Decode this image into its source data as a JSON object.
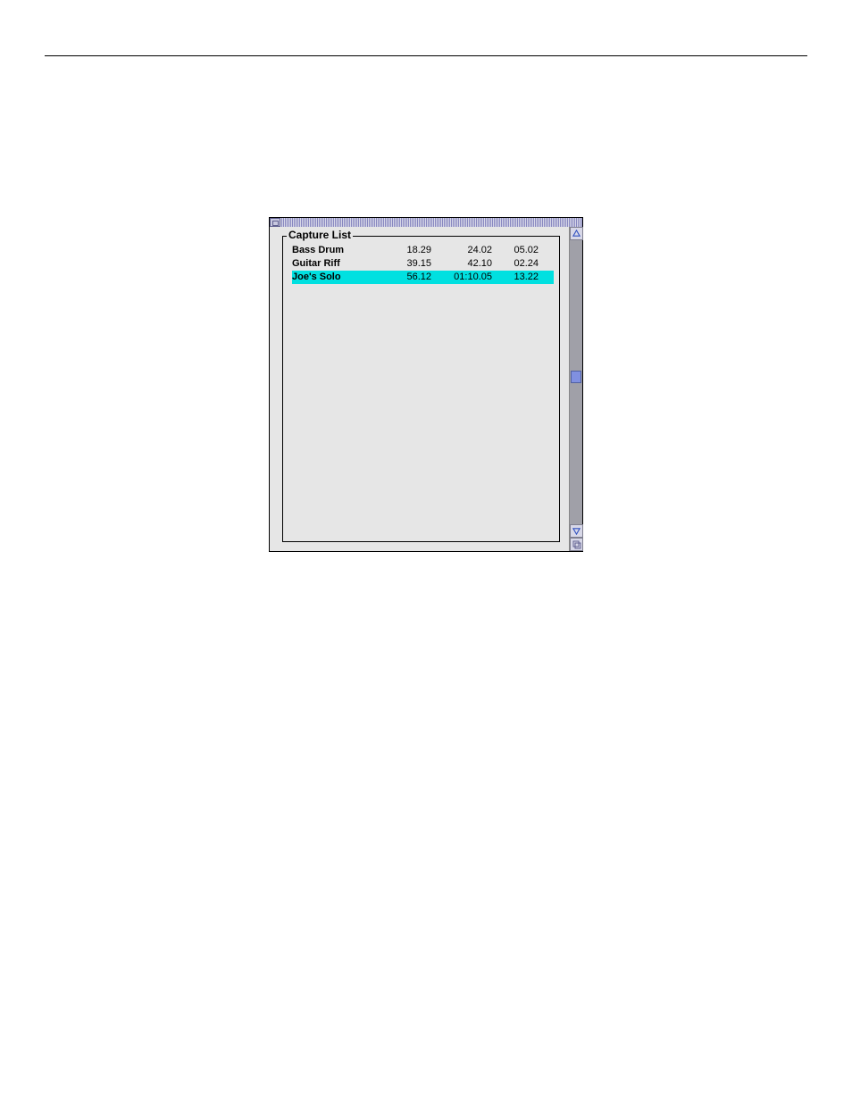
{
  "panel": {
    "legend": "Capture List",
    "rows": [
      {
        "name": "Bass Drum",
        "v1": "18.29",
        "v2": "24.02",
        "v3": "05.02",
        "selected": false
      },
      {
        "name": "Guitar Riff",
        "v1": "39.15",
        "v2": "42.10",
        "v3": "02.24",
        "selected": false
      },
      {
        "name": "Joe's Solo",
        "v1": "56.12",
        "v2": "01:10.05",
        "v3": "13.22",
        "selected": true
      }
    ]
  }
}
